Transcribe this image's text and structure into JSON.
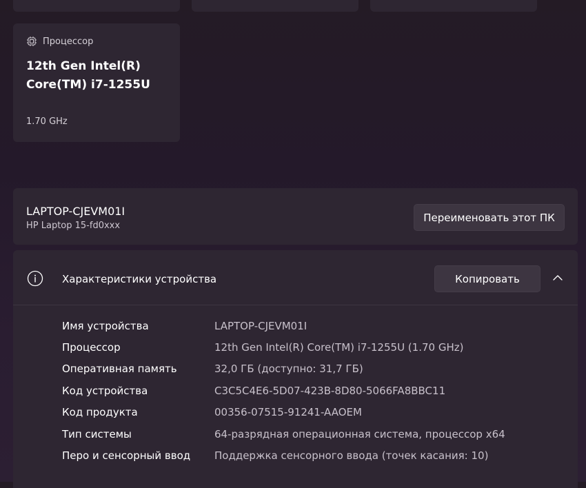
{
  "processor_card": {
    "heading": "Процессор",
    "name": "12th Gen Intel(R) Core(TM) i7-1255U",
    "frequency": "1.70 GHz"
  },
  "pc_card": {
    "name": "LAPTOP-CJEVM01I",
    "model": "HP Laptop 15-fd0xxx",
    "rename_label": "Переименовать этот ПК"
  },
  "specs": {
    "title": "Характеристики устройства",
    "copy_label": "Копировать",
    "rows": [
      {
        "label": "Имя устройства",
        "value": "LAPTOP-CJEVM01I"
      },
      {
        "label": "Процессор",
        "value": "12th Gen Intel(R) Core(TM) i7-1255U (1.70 GHz)"
      },
      {
        "label": "Оперативная память",
        "value": "32,0 ГБ (доступно: 31,7 ГБ)"
      },
      {
        "label": "Код устройства",
        "value": "C3C5C4E6-5D07-423B-8D80-5066FA8BBC11"
      },
      {
        "label": "Код продукта",
        "value": "00356-07515-91241-AAOEM"
      },
      {
        "label": "Тип системы",
        "value": "64-разрядная операционная система, процессор x64"
      },
      {
        "label": "Перо и сенсорный ввод",
        "value": "Поддержка сенсорного ввода (точек касания: 10)"
      }
    ]
  },
  "icons": {
    "processor": "cpu-chip-icon",
    "info": "info-circle-icon",
    "collapse": "chevron-up-icon"
  },
  "colors": {
    "background": "#24192a",
    "card": "#2e2632",
    "button": "#3d3541",
    "secondary_text": "#c8c1cb"
  }
}
